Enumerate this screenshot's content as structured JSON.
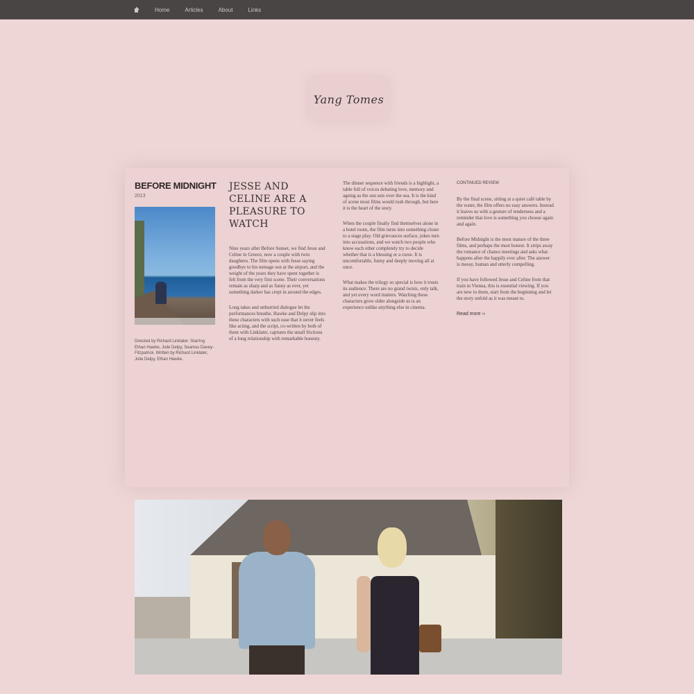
{
  "nav": {
    "items": [
      "Home",
      "Articles",
      "About",
      "Links"
    ]
  },
  "logo": {
    "text": "Yang Tomes"
  },
  "article": {
    "side_title": "Before Midnight",
    "side_year": "2013",
    "poster_label": "Before Midnight poster",
    "side_text": "Directed by Richard Linklater. Starring Ethan Hawke, Julie Delpy, Seamus Davey-Fitzpatrick. Written by Richard Linklater, Julie Delpy, Ethan Hawke.",
    "headline": "Jesse and Celine are a pleasure to watch",
    "col1": [
      "Nine years after Before Sunset, we find Jesse and Celine in Greece, now a couple with twin daughters. The film opens with Jesse saying goodbye to his teenage son at the airport, and the weight of the years they have spent together is felt from the very first scene. Their conversations remain as sharp and as funny as ever, yet something darker has crept in around the edges.",
      "Long takes and unhurried dialogue let the performances breathe. Hawke and Delpy slip into these characters with such ease that it never feels like acting, and the script, co-written by both of them with Linklater, captures the small frictions of a long relationship with remarkable honesty."
    ],
    "col2": [
      "The dinner sequence with friends is a highlight, a table full of voices debating love, memory and ageing as the sun sets over the sea. It is the kind of scene most films would rush through, but here it is the heart of the story.",
      "When the couple finally find themselves alone in a hotel room, the film turns into something closer to a stage play. Old grievances surface, jokes turn into accusations, and we watch two people who know each other completely try to decide whether that is a blessing or a curse. It is uncomfortable, funny and deeply moving all at once.",
      "What makes the trilogy so special is how it trusts its audience. There are no grand twists, only talk, and yet every word matters. Watching these characters grow older alongside us is an experience unlike anything else in cinema."
    ],
    "col3_kicker": "Continued review",
    "col3": [
      "By the final scene, sitting at a quiet café table by the water, the film offers no easy answers. Instead it leaves us with a gesture of tenderness and a reminder that love is something you choose again and again.",
      "Before Midnight is the most mature of the three films, and perhaps the most honest. It strips away the romance of chance meetings and asks what happens after the happily ever after. The answer is messy, human and utterly compelling.",
      "If you have followed Jesse and Celine from that train in Vienna, this is essential viewing. If you are new to them, start from the beginning and let the story unfold as it was meant to."
    ],
    "more_link": "Read more ››"
  },
  "still": {
    "label": "Film still: Jesse and Celine walking"
  }
}
